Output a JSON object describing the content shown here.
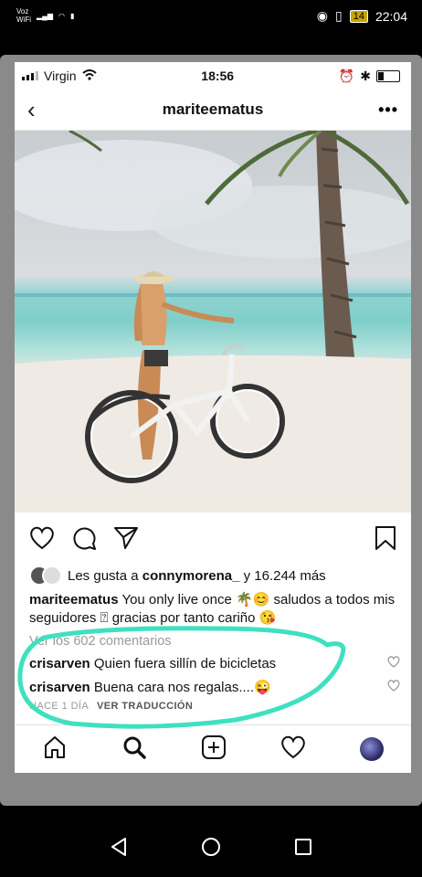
{
  "android_status": {
    "network_label": "Voz\nWiFi",
    "time": "22:04",
    "battery": "14"
  },
  "ios_status": {
    "carrier": "Virgin",
    "time": "18:56"
  },
  "header": {
    "username": "mariteematus",
    "back_icon": "back-chevron-icon",
    "more_icon": "more-dots-icon"
  },
  "post": {
    "likes_prefix": "Les gusta a ",
    "likes_user": "connymorena_",
    "likes_suffix": " y 16.244 más",
    "caption_user": "mariteematus",
    "caption_text": "You only live once 🌴😊 saludos a todos mis seguidores ⍰ gracias por tanto cariño 😘",
    "view_comments": "Ver los 602 comentarios",
    "comments": [
      {
        "user": "crisarven",
        "text": "Quien fuera sillín de bicicletas"
      },
      {
        "user": "crisarven",
        "text": "Buena cara nos regalas....😜"
      }
    ],
    "timestamp": "HACE 1 DÍA",
    "translate": "VER TRADUCCIÓN"
  },
  "colors": {
    "highlight": "#3fe0c0",
    "ocean": "#7fcfc9"
  },
  "tabbar": [
    "home-icon",
    "search-icon",
    "add-post-icon",
    "activity-heart-icon",
    "profile-avatar"
  ]
}
